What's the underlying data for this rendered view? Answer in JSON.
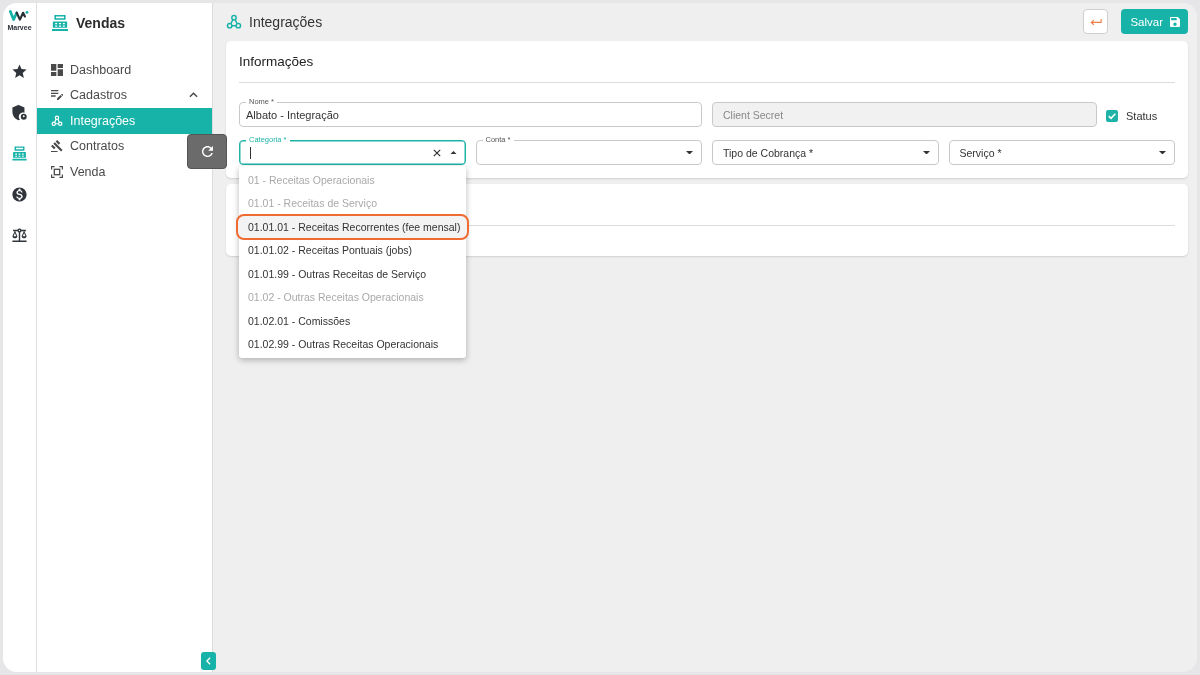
{
  "rail": {
    "logo_text": "Marvee",
    "items": [
      {
        "selected": false
      },
      {
        "selected": false
      },
      {
        "selected": true
      },
      {
        "selected": false
      },
      {
        "selected": false
      }
    ]
  },
  "sidebar": {
    "title": "Vendas",
    "items": [
      {
        "label": "Dashboard",
        "selected": false
      },
      {
        "label": "Cadastros",
        "selected": false,
        "expanded": true,
        "children": [
          {
            "label": "Integrações",
            "selected": true
          },
          {
            "label": "Contratos",
            "selected": false
          },
          {
            "label": "Venda",
            "selected": false
          }
        ]
      }
    ]
  },
  "header": {
    "title": "Integrações",
    "save_label": "Salvar"
  },
  "info_card": {
    "title": "Informações",
    "name_field": {
      "label": "Nome *",
      "value": "Albato - Integração"
    },
    "secret_field": {
      "label": "Client Secret",
      "disabled": true
    },
    "status": {
      "label": "Status",
      "checked": true
    },
    "selects": [
      {
        "label": "Categoria *",
        "floating": true,
        "focused": true,
        "open": true,
        "clearable": true,
        "options": [
          {
            "label": "01 - Receitas Operacionais",
            "disabled": true,
            "highlighted": false
          },
          {
            "label": "01.01 - Receitas de Serviço",
            "disabled": true,
            "highlighted": false
          },
          {
            "label": "01.01.01 - Receitas Recorrentes (fee mensal)",
            "disabled": false,
            "highlighted": true
          },
          {
            "label": "01.01.02 - Receitas Pontuais (jobs)",
            "disabled": false,
            "highlighted": false
          },
          {
            "label": "01.01.99 - Outras Receitas de Serviço",
            "disabled": false,
            "highlighted": false
          },
          {
            "label": "01.02 - Outras Receitas Operacionais",
            "disabled": true,
            "highlighted": false
          },
          {
            "label": "01.02.01 - Comissões",
            "disabled": false,
            "highlighted": false
          },
          {
            "label": "01.02.99 - Outras Receitas Operacionais",
            "disabled": false,
            "highlighted": false
          }
        ]
      },
      {
        "label": "Conta *",
        "floating": true,
        "focused": false,
        "open": false,
        "clearable": false
      },
      {
        "label": "Tipo de Cobrança *",
        "floating": false,
        "focused": false,
        "open": false,
        "clearable": false
      },
      {
        "label": "Serviço *",
        "floating": false,
        "focused": false,
        "open": false,
        "clearable": false
      }
    ]
  }
}
